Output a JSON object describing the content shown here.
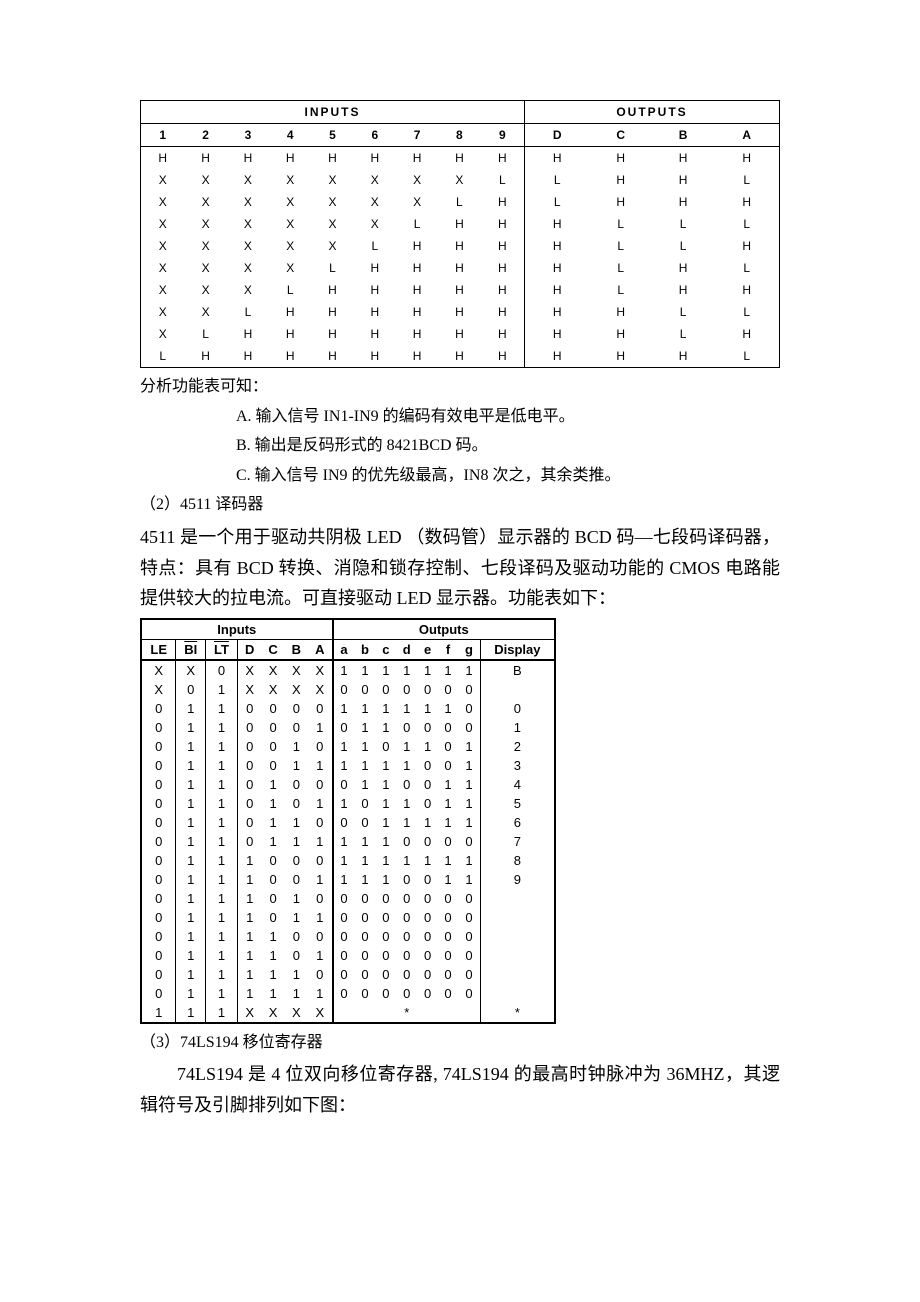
{
  "table1": {
    "group_headers": [
      "INPUTS",
      "OUTPUTS"
    ],
    "col_headers": [
      "1",
      "2",
      "3",
      "4",
      "5",
      "6",
      "7",
      "8",
      "9",
      "D",
      "C",
      "B",
      "A"
    ],
    "rows": [
      [
        "H",
        "H",
        "H",
        "H",
        "H",
        "H",
        "H",
        "H",
        "H",
        "H",
        "H",
        "H",
        "H"
      ],
      [
        "X",
        "X",
        "X",
        "X",
        "X",
        "X",
        "X",
        "X",
        "L",
        "L",
        "H",
        "H",
        "L"
      ],
      [
        "X",
        "X",
        "X",
        "X",
        "X",
        "X",
        "X",
        "L",
        "H",
        "L",
        "H",
        "H",
        "H"
      ],
      [
        "X",
        "X",
        "X",
        "X",
        "X",
        "X",
        "L",
        "H",
        "H",
        "H",
        "L",
        "L",
        "L"
      ],
      [
        "X",
        "X",
        "X",
        "X",
        "X",
        "L",
        "H",
        "H",
        "H",
        "H",
        "L",
        "L",
        "H"
      ],
      [
        "X",
        "X",
        "X",
        "X",
        "L",
        "H",
        "H",
        "H",
        "H",
        "H",
        "L",
        "H",
        "L"
      ],
      [
        "X",
        "X",
        "X",
        "L",
        "H",
        "H",
        "H",
        "H",
        "H",
        "H",
        "L",
        "H",
        "H"
      ],
      [
        "X",
        "X",
        "L",
        "H",
        "H",
        "H",
        "H",
        "H",
        "H",
        "H",
        "H",
        "L",
        "L"
      ],
      [
        "X",
        "L",
        "H",
        "H",
        "H",
        "H",
        "H",
        "H",
        "H",
        "H",
        "H",
        "L",
        "H"
      ],
      [
        "L",
        "H",
        "H",
        "H",
        "H",
        "H",
        "H",
        "H",
        "H",
        "H",
        "H",
        "H",
        "L"
      ]
    ]
  },
  "text": {
    "analysis_intro": "分析功能表可知：",
    "point_a": "A. 输入信号 IN1-IN9 的编码有效电平是低电平。",
    "point_b": "B. 输出是反码形式的 8421BCD 码。",
    "point_c": "C. 输入信号 IN9 的优先级最高，IN8 次之，其余类推。",
    "section2_title": "（2）4511 译码器",
    "para_4511": "4511 是一个用于驱动共阴极 LED （数码管）显示器的 BCD 码—七段码译码器，特点：具有 BCD 转换、消隐和锁存控制、七段译码及驱动功能的 CMOS 电路能提供较大的拉电流。可直接驱动 LED 显示器。功能表如下：",
    "section3_title": "（3）74LS194 移位寄存器",
    "para_194": "　　74LS194 是 4 位双向移位寄存器, 74LS194 的最高时钟脉冲为 36MHZ，其逻辑符号及引脚排列如下图："
  },
  "table2": {
    "group_headers": [
      "Inputs",
      "Outputs"
    ],
    "col_headers": [
      "LE",
      "BI",
      "LT",
      "D",
      "C",
      "B",
      "A",
      "a",
      "b",
      "c",
      "d",
      "e",
      "f",
      "g",
      "Display"
    ],
    "rows": [
      [
        "X",
        "X",
        "0",
        "X",
        "X",
        "X",
        "X",
        "1",
        "1",
        "1",
        "1",
        "1",
        "1",
        "1",
        "B"
      ],
      [
        "X",
        "0",
        "1",
        "X",
        "X",
        "X",
        "X",
        "0",
        "0",
        "0",
        "0",
        "0",
        "0",
        "0",
        ""
      ],
      [
        "0",
        "1",
        "1",
        "0",
        "0",
        "0",
        "0",
        "1",
        "1",
        "1",
        "1",
        "1",
        "1",
        "0",
        "0"
      ],
      [
        "0",
        "1",
        "1",
        "0",
        "0",
        "0",
        "1",
        "0",
        "1",
        "1",
        "0",
        "0",
        "0",
        "0",
        "1"
      ],
      [
        "0",
        "1",
        "1",
        "0",
        "0",
        "1",
        "0",
        "1",
        "1",
        "0",
        "1",
        "1",
        "0",
        "1",
        "2"
      ],
      [
        "0",
        "1",
        "1",
        "0",
        "0",
        "1",
        "1",
        "1",
        "1",
        "1",
        "1",
        "0",
        "0",
        "1",
        "3"
      ],
      [
        "0",
        "1",
        "1",
        "0",
        "1",
        "0",
        "0",
        "0",
        "1",
        "1",
        "0",
        "0",
        "1",
        "1",
        "4"
      ],
      [
        "0",
        "1",
        "1",
        "0",
        "1",
        "0",
        "1",
        "1",
        "0",
        "1",
        "1",
        "0",
        "1",
        "1",
        "5"
      ],
      [
        "0",
        "1",
        "1",
        "0",
        "1",
        "1",
        "0",
        "0",
        "0",
        "1",
        "1",
        "1",
        "1",
        "1",
        "6"
      ],
      [
        "0",
        "1",
        "1",
        "0",
        "1",
        "1",
        "1",
        "1",
        "1",
        "1",
        "0",
        "0",
        "0",
        "0",
        "7"
      ],
      [
        "0",
        "1",
        "1",
        "1",
        "0",
        "0",
        "0",
        "1",
        "1",
        "1",
        "1",
        "1",
        "1",
        "1",
        "8"
      ],
      [
        "0",
        "1",
        "1",
        "1",
        "0",
        "0",
        "1",
        "1",
        "1",
        "1",
        "0",
        "0",
        "1",
        "1",
        "9"
      ],
      [
        "0",
        "1",
        "1",
        "1",
        "0",
        "1",
        "0",
        "0",
        "0",
        "0",
        "0",
        "0",
        "0",
        "0",
        ""
      ],
      [
        "0",
        "1",
        "1",
        "1",
        "0",
        "1",
        "1",
        "0",
        "0",
        "0",
        "0",
        "0",
        "0",
        "0",
        ""
      ],
      [
        "0",
        "1",
        "1",
        "1",
        "1",
        "0",
        "0",
        "0",
        "0",
        "0",
        "0",
        "0",
        "0",
        "0",
        ""
      ],
      [
        "0",
        "1",
        "1",
        "1",
        "1",
        "0",
        "1",
        "0",
        "0",
        "0",
        "0",
        "0",
        "0",
        "0",
        ""
      ],
      [
        "0",
        "1",
        "1",
        "1",
        "1",
        "1",
        "0",
        "0",
        "0",
        "0",
        "0",
        "0",
        "0",
        "0",
        ""
      ],
      [
        "0",
        "1",
        "1",
        "1",
        "1",
        "1",
        "1",
        "0",
        "0",
        "0",
        "0",
        "0",
        "0",
        "0",
        ""
      ],
      [
        "1",
        "1",
        "1",
        "X",
        "X",
        "X",
        "X",
        "",
        "",
        "",
        "*",
        "",
        "",
        "",
        "*"
      ]
    ]
  }
}
